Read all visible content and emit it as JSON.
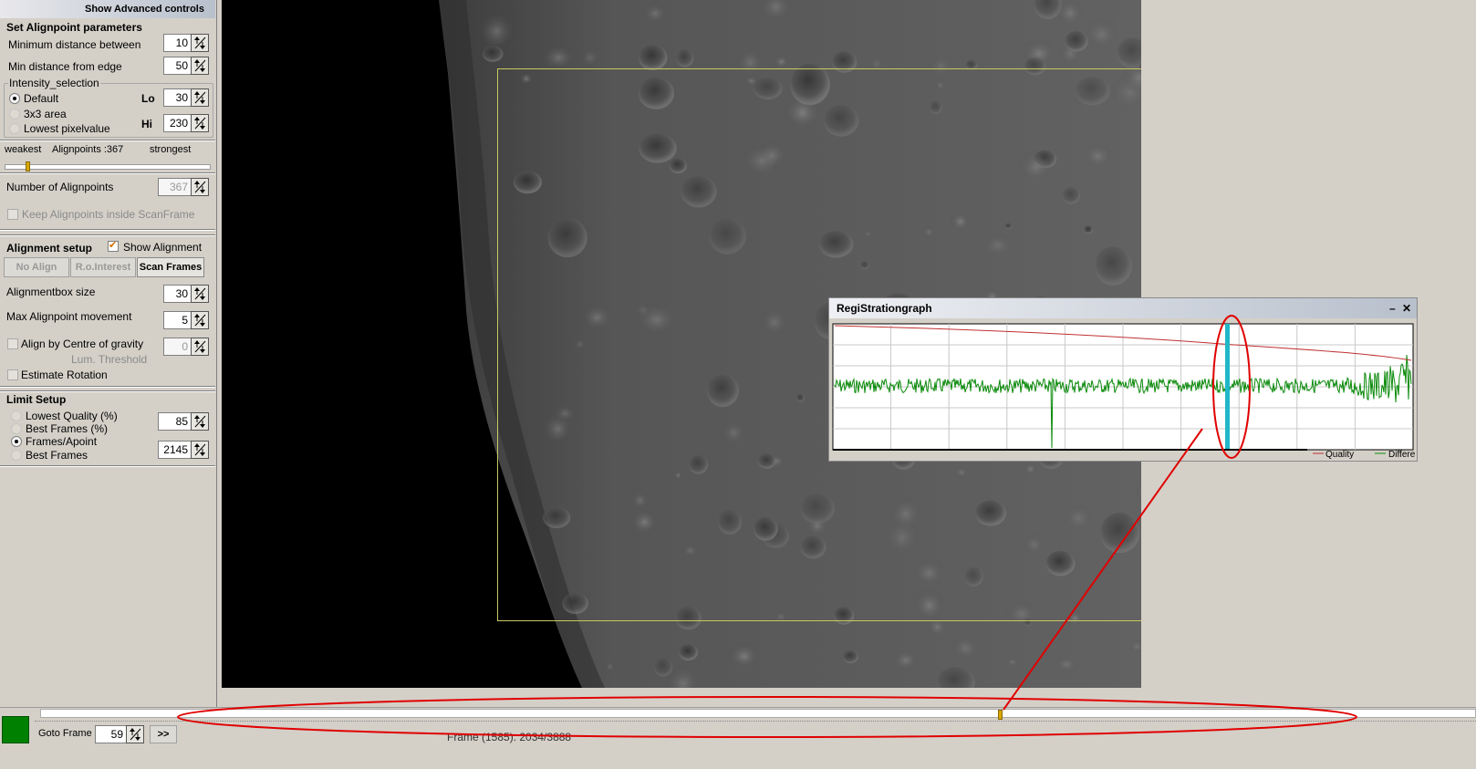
{
  "panel": {
    "show_advanced": "Show Advanced controls",
    "alignpoint_params": {
      "title": "Set Alignpoint parameters",
      "min_distance_label": "Minimum distance between",
      "min_distance_value": "10",
      "min_edge_label": "Min distance from edge",
      "min_edge_value": "50",
      "intensity_title": "Intensity_selection",
      "options": [
        "Default",
        "3x3 area",
        "Lowest pixelvalue"
      ],
      "selected_option": "Default",
      "lo_label": "Lo",
      "lo_value": "30",
      "hi_label": "Hi",
      "hi_value": "230"
    },
    "strength": {
      "weakest": "weakest",
      "count_label": "Alignpoints :367",
      "strongest": "strongest",
      "slider_level": 0.1
    },
    "number_label": "Number of Alignpoints",
    "number_value": "367",
    "keep_inside_label": "Keep Alignpoints inside ScanFrame",
    "keep_inside_checked": false,
    "alignment": {
      "title": "Alignment setup",
      "show_alignment_label": "Show Alignment",
      "show_alignment_checked": true,
      "buttons": [
        "No Align",
        "R.o.Interest",
        "Scan Frames"
      ],
      "active_button": "Scan Frames",
      "box_size_label": "Alignmentbox size",
      "box_size_value": "30",
      "max_move_label": "Max Alignpoint movement",
      "max_move_value": "5",
      "centre_gravity_label": "Align by Centre of gravity",
      "centre_gravity_checked": false,
      "lum_threshold_label": "Lum. Threshold",
      "lum_threshold_value": "0",
      "estimate_rotation_label": "Estimate Rotation",
      "estimate_rotation_checked": false
    },
    "limit": {
      "title": "Limit Setup",
      "options": [
        "Lowest Quality (%)",
        "Best Frames (%)",
        "Frames/Apoint",
        "Best Frames"
      ],
      "selected_option": "Frames/Apoint",
      "value_1": "85",
      "value_2": "2145"
    }
  },
  "graph_window": {
    "title": "RegiStrationgraph",
    "minimize": "–",
    "close": "✕",
    "legend": [
      "Quality",
      "Differe"
    ],
    "colors": {
      "quality": "#c03030",
      "difference": "#0a8a0a",
      "marker": "#20b8c8"
    }
  },
  "bottom": {
    "goto_label": "Goto Frame",
    "goto_value": "59",
    "next_button": ">>",
    "frame_status": "Frame (1585): 2034/3888",
    "timeline_position": 0.667
  },
  "colors": {
    "annotation": "#e00000",
    "scanframe": "#c8c860",
    "status_green": "#008000"
  }
}
